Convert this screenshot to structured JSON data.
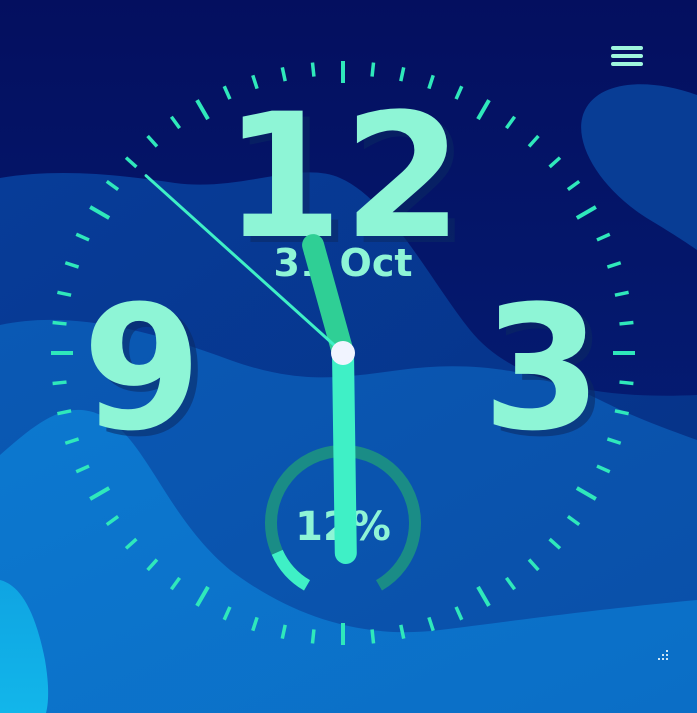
{
  "clock": {
    "numerals": {
      "n12": "12",
      "n3": "3",
      "n9": "9"
    },
    "date": "31 Oct",
    "battery": {
      "label": "12%",
      "level": 0.12
    },
    "time": {
      "hour": 11,
      "minute": 29,
      "second": 52
    }
  },
  "icons": {
    "menu": "hamburger-menu-icon",
    "resize": "resize-grip-icon"
  },
  "colors": {
    "accent": "#8ef5d6",
    "accent_strong": "#3ff0c6",
    "hour_hand": "#2fcf95",
    "ring_track": "#1a8c86",
    "background_dark": "#031566",
    "background_light": "#0a7fd1"
  }
}
